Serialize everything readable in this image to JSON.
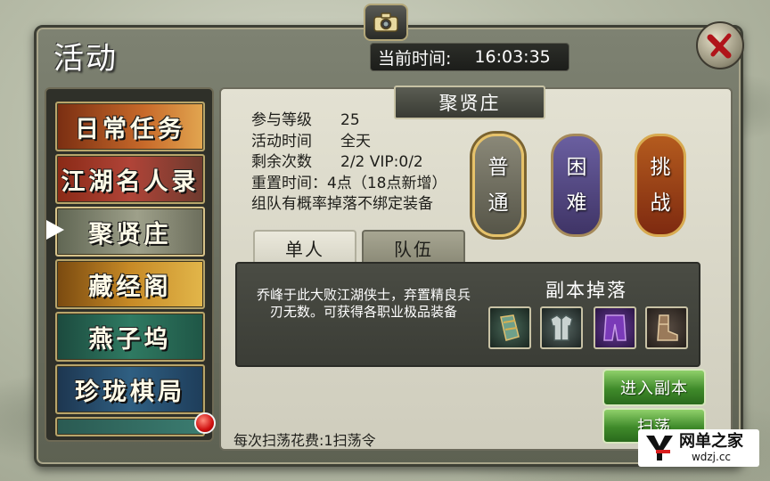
{
  "header": {
    "title": "活动",
    "time_label": "当前时间:",
    "time_value": "16:03:35"
  },
  "sidebar": {
    "items": [
      {
        "label": "日常任务"
      },
      {
        "label": "江湖名人录"
      },
      {
        "label": "聚贤庄",
        "selected": true
      },
      {
        "label": "藏经阁"
      },
      {
        "label": "燕子坞"
      },
      {
        "label": "珍珑棋局"
      },
      {
        "label": ""
      }
    ]
  },
  "dungeon": {
    "title": "聚贤庄",
    "info": [
      {
        "key": "参与等级",
        "value": "25"
      },
      {
        "key": "活动时间",
        "value": "全天"
      },
      {
        "key": "剩余次数",
        "value": "2/2 VIP:0/2"
      }
    ],
    "reset_line": "重置时间：4点（18点新增）",
    "team_note": "组队有概率掉落不绑定装备",
    "difficulties": [
      {
        "line1": "普",
        "line2": "通"
      },
      {
        "line1": "困",
        "line2": "难"
      },
      {
        "line1": "挑",
        "line2": "战"
      }
    ],
    "tabs": [
      "单人",
      "队伍"
    ],
    "description": "乔峰于此大败江湖侠士，弃置精良兵刃无数。可获得各职业极品装备",
    "drops_title": "副本掉落",
    "drop_icons": [
      "bracer-icon",
      "armor-icon",
      "pants-icon",
      "boots-icon"
    ],
    "enter_button": "进入副本",
    "sweep_button": "扫荡",
    "sweep_cost": "每次扫荡花费:1扫荡令"
  },
  "watermark": {
    "name": "网单之家",
    "url": "wdzj.cc"
  },
  "colors": {
    "button_green": "#3f8a2a",
    "panel_dark": "#3b3d36",
    "parchment": "#e3e1d2"
  }
}
